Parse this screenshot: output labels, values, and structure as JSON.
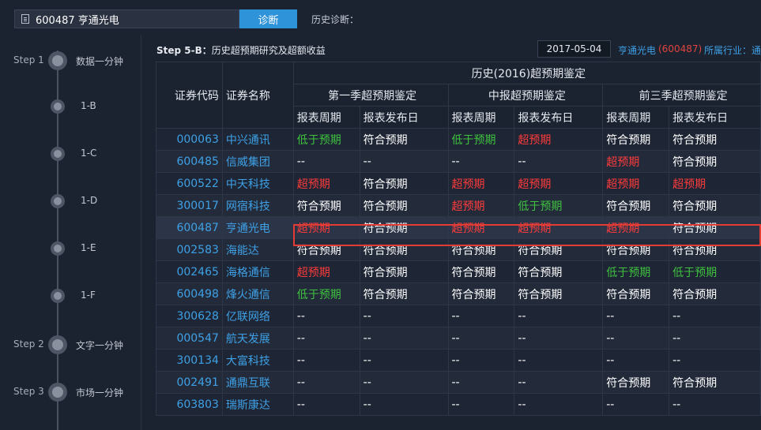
{
  "topbar": {
    "search_value": "600487 亨通光电",
    "diagnose_label": "诊断",
    "history_label": "历史诊断："
  },
  "sidebar": {
    "nodes": [
      {
        "step": "Step 1",
        "label": "数据一分钟"
      },
      {
        "step": "",
        "label": "1-B"
      },
      {
        "step": "",
        "label": "1-C"
      },
      {
        "step": "",
        "label": "1-D"
      },
      {
        "step": "",
        "label": "1-E"
      },
      {
        "step": "",
        "label": "1-F"
      },
      {
        "step": "Step 2",
        "label": "文字一分钟"
      },
      {
        "step": "Step 3",
        "label": "市场一分钟"
      }
    ]
  },
  "main": {
    "title_bold": "Step 5-B：",
    "title_rest": "历史超预期研究及超额收益",
    "date": "2017-05-04",
    "stock_name": "亨通光电",
    "stock_code": "(600487)",
    "industry_label": "所属行业：",
    "industry_value": "通"
  },
  "table": {
    "header_top": "历史(2016)超预期鉴定",
    "col_code": "证券代码",
    "col_name": "证券名称",
    "groups": [
      "第一季超预期鉴定",
      "中报超预期鉴定",
      "前三季超预期鉴定"
    ],
    "sub_cols": [
      "报表周期",
      "报表发布日",
      "报表周期",
      "报表发布日",
      "报表周期",
      "报表发布日"
    ],
    "rows": [
      {
        "code": "000063",
        "name": "中兴通讯",
        "cells": [
          "低于预期",
          "符合预期",
          "低于预期",
          "超预期",
          "符合预期",
          "符合预期"
        ]
      },
      {
        "code": "600485",
        "name": "信威集团",
        "cells": [
          "--",
          "--",
          "--",
          "--",
          "超预期",
          "符合预期"
        ]
      },
      {
        "code": "600522",
        "name": "中天科技",
        "cells": [
          "超预期",
          "符合预期",
          "超预期",
          "超预期",
          "超预期",
          "超预期"
        ]
      },
      {
        "code": "300017",
        "name": "网宿科技",
        "cells": [
          "符合预期",
          "符合预期",
          "超预期",
          "低于预期",
          "符合预期",
          "符合预期"
        ]
      },
      {
        "code": "600487",
        "name": "亨通光电",
        "cells": [
          "超预期",
          "符合预期",
          "超预期",
          "超预期",
          "超预期",
          "符合预期"
        ]
      },
      {
        "code": "002583",
        "name": "海能达",
        "cells": [
          "符合预期",
          "符合预期",
          "符合预期",
          "符合预期",
          "符合预期",
          "符合预期"
        ]
      },
      {
        "code": "002465",
        "name": "海格通信",
        "cells": [
          "超预期",
          "符合预期",
          "符合预期",
          "符合预期",
          "低于预期",
          "低于预期"
        ]
      },
      {
        "code": "600498",
        "name": "烽火通信",
        "cells": [
          "低于预期",
          "符合预期",
          "符合预期",
          "符合预期",
          "符合预期",
          "符合预期"
        ]
      },
      {
        "code": "300628",
        "name": "亿联网络",
        "cells": [
          "--",
          "--",
          "--",
          "--",
          "--",
          "--"
        ]
      },
      {
        "code": "000547",
        "name": "航天发展",
        "cells": [
          "--",
          "--",
          "--",
          "--",
          "--",
          "--"
        ]
      },
      {
        "code": "300134",
        "name": "大富科技",
        "cells": [
          "--",
          "--",
          "--",
          "--",
          "--",
          "--"
        ]
      },
      {
        "code": "002491",
        "name": "通鼎互联",
        "cells": [
          "--",
          "--",
          "--",
          "--",
          "符合预期",
          "符合预期"
        ]
      },
      {
        "code": "603803",
        "name": "瑞斯康达",
        "cells": [
          "--",
          "--",
          "--",
          "--",
          "--",
          "--"
        ]
      }
    ]
  },
  "colors": {
    "above": "#ff3b3b",
    "below": "#3fc23f",
    "meet": "#ffffff",
    "link": "#3ea1e6",
    "highlight": "#e23c35"
  }
}
